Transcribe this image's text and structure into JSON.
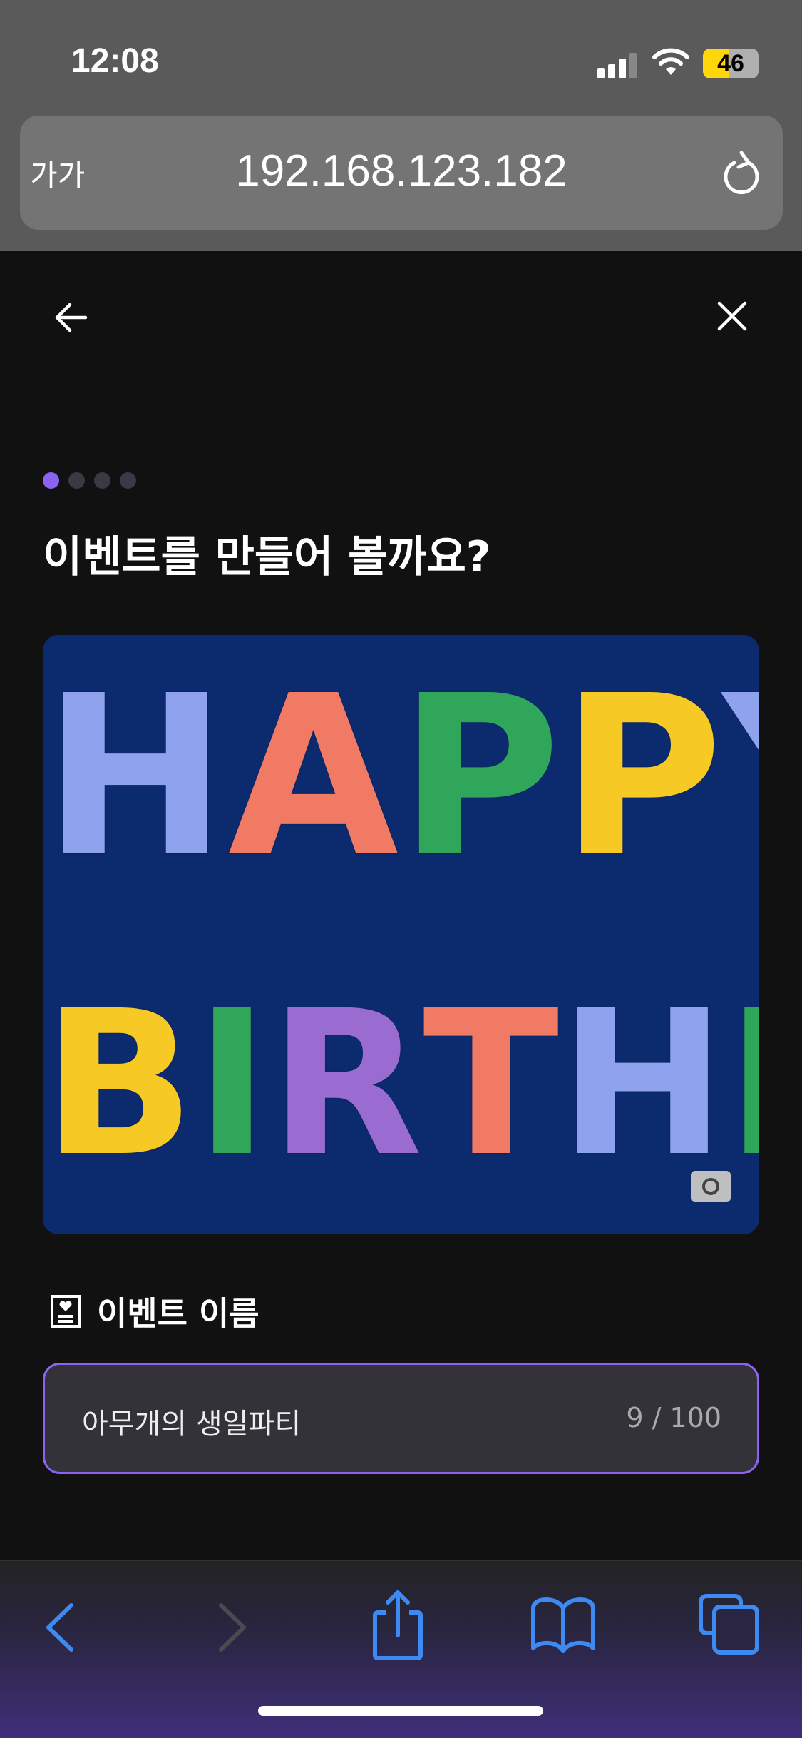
{
  "status_bar": {
    "time": "12:08",
    "battery": "46"
  },
  "browser": {
    "text_size_label": "가가",
    "url": "192.168.123.182"
  },
  "page": {
    "step_total": 4,
    "step_current": 1,
    "title": "이벤트를 만들어 볼까요?",
    "hero_image": {
      "line1": "HAPPY",
      "line2": "BIRTHDAY"
    },
    "event_name_label": "이벤트 이름",
    "event_name_value": "아무개의 생일파티",
    "event_name_counter": "9 / 100"
  },
  "colors": {
    "accent": "#8a63f0",
    "toolbar_blue": "#3d8bf2"
  }
}
